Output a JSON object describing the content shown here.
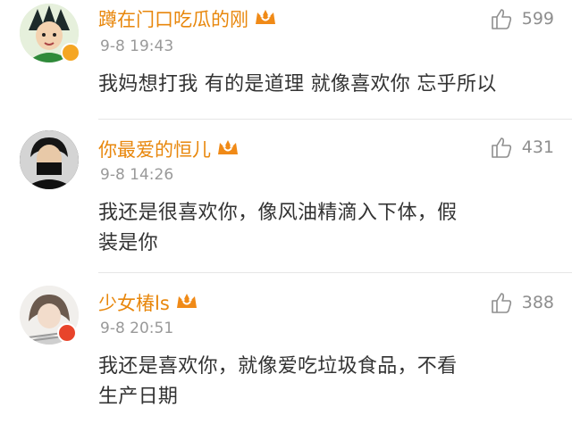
{
  "comments": [
    {
      "username": "蹲在门口吃瓜的刚",
      "time": "9-8 19:43",
      "likes": "599",
      "text": "我妈想打我 有的是道理 就像喜欢你 忘乎所以",
      "badge": "vip-crown-icon",
      "verified_color": "#f5a623"
    },
    {
      "username": "你最爱的恒儿",
      "time": "9-8 14:26",
      "likes": "431",
      "text": "我还是很喜欢你，像风油精滴入下体，假装是你",
      "badge": "vip-crown-icon"
    },
    {
      "username": "少女椿ls",
      "time": "9-8 20:51",
      "likes": "388",
      "text": "我还是喜欢你，就像爱吃垃圾食品，不看生产日期",
      "badge": "vip-crown-icon",
      "verified_color": "#e8442b"
    }
  ],
  "colors": {
    "username": "#e8870c",
    "time": "#999999",
    "text": "#333333",
    "like": "#8e8e8e"
  }
}
